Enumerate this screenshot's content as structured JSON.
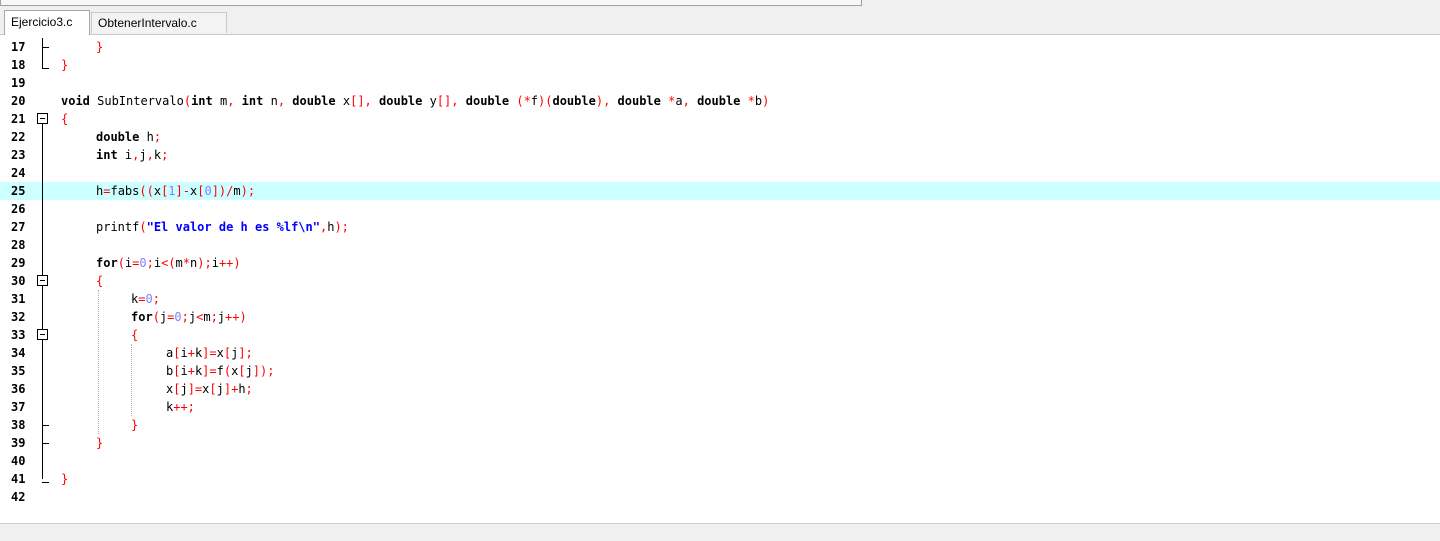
{
  "tabs": [
    {
      "label": "Ejercicio3.c",
      "active": true
    },
    {
      "label": "ObtenerIntervalo.c",
      "active": false
    }
  ],
  "editor": {
    "current_line": 25,
    "lines": [
      {
        "n": 17,
        "indent": 1,
        "tokens": [
          [
            "op",
            "}"
          ]
        ]
      },
      {
        "n": 18,
        "indent": 0,
        "tokens": [
          [
            "op",
            "}"
          ]
        ]
      },
      {
        "n": 19,
        "indent": 0,
        "tokens": []
      },
      {
        "n": 20,
        "indent": 0,
        "tokens": [
          [
            "kw",
            "void"
          ],
          [
            "id",
            " SubIntervalo"
          ],
          [
            "op",
            "("
          ],
          [
            "kw",
            "int"
          ],
          [
            "id",
            " m"
          ],
          [
            "op",
            ","
          ],
          [
            "id",
            " "
          ],
          [
            "kw",
            "int"
          ],
          [
            "id",
            " n"
          ],
          [
            "op",
            ","
          ],
          [
            "id",
            " "
          ],
          [
            "kw",
            "double"
          ],
          [
            "id",
            " x"
          ],
          [
            "op",
            "[],"
          ],
          [
            "id",
            " "
          ],
          [
            "kw",
            "double"
          ],
          [
            "id",
            " y"
          ],
          [
            "op",
            "[],"
          ],
          [
            "id",
            " "
          ],
          [
            "kw",
            "double"
          ],
          [
            "id",
            " "
          ],
          [
            "op",
            "(*"
          ],
          [
            "id",
            "f"
          ],
          [
            "op",
            ")("
          ],
          [
            "kw",
            "double"
          ],
          [
            "op",
            "),"
          ],
          [
            "id",
            " "
          ],
          [
            "kw",
            "double"
          ],
          [
            "id",
            " "
          ],
          [
            "op",
            "*"
          ],
          [
            "id",
            "a"
          ],
          [
            "op",
            ","
          ],
          [
            "id",
            " "
          ],
          [
            "kw",
            "double"
          ],
          [
            "id",
            " "
          ],
          [
            "op",
            "*"
          ],
          [
            "id",
            "b"
          ],
          [
            "op",
            ")"
          ]
        ]
      },
      {
        "n": 21,
        "indent": 0,
        "tokens": [
          [
            "op",
            "{"
          ]
        ]
      },
      {
        "n": 22,
        "indent": 1,
        "tokens": [
          [
            "kw",
            "double"
          ],
          [
            "id",
            " h"
          ],
          [
            "op",
            ";"
          ]
        ]
      },
      {
        "n": 23,
        "indent": 1,
        "tokens": [
          [
            "kw",
            "int"
          ],
          [
            "id",
            " i"
          ],
          [
            "op",
            ","
          ],
          [
            "id",
            "j"
          ],
          [
            "op",
            ","
          ],
          [
            "id",
            "k"
          ],
          [
            "op",
            ";"
          ]
        ]
      },
      {
        "n": 24,
        "indent": 0,
        "tokens": []
      },
      {
        "n": 25,
        "indent": 1,
        "tokens": [
          [
            "id",
            "h"
          ],
          [
            "op",
            "="
          ],
          [
            "id",
            "fabs"
          ],
          [
            "op",
            "(("
          ],
          [
            "id",
            "x"
          ],
          [
            "op",
            "["
          ],
          [
            "num",
            "1"
          ],
          [
            "op",
            "]-"
          ],
          [
            "id",
            "x"
          ],
          [
            "op",
            "["
          ],
          [
            "num",
            "0"
          ],
          [
            "op",
            "])/"
          ],
          [
            "id",
            "m"
          ],
          [
            "op",
            ");"
          ]
        ]
      },
      {
        "n": 26,
        "indent": 0,
        "tokens": []
      },
      {
        "n": 27,
        "indent": 1,
        "tokens": [
          [
            "id",
            "printf"
          ],
          [
            "op",
            "("
          ],
          [
            "str",
            "\"El valor de h es %lf\\n\""
          ],
          [
            "op",
            ","
          ],
          [
            "id",
            "h"
          ],
          [
            "op",
            ");"
          ]
        ]
      },
      {
        "n": 28,
        "indent": 0,
        "tokens": []
      },
      {
        "n": 29,
        "indent": 1,
        "tokens": [
          [
            "kw",
            "for"
          ],
          [
            "op",
            "("
          ],
          [
            "id",
            "i"
          ],
          [
            "op",
            "="
          ],
          [
            "num",
            "0"
          ],
          [
            "op",
            ";"
          ],
          [
            "id",
            "i"
          ],
          [
            "op",
            "<("
          ],
          [
            "id",
            "m"
          ],
          [
            "op",
            "*"
          ],
          [
            "id",
            "n"
          ],
          [
            "op",
            ");"
          ],
          [
            "id",
            "i"
          ],
          [
            "op",
            "++)"
          ]
        ]
      },
      {
        "n": 30,
        "indent": 1,
        "tokens": [
          [
            "op",
            "{"
          ]
        ]
      },
      {
        "n": 31,
        "indent": 2,
        "tokens": [
          [
            "id",
            "k"
          ],
          [
            "op",
            "="
          ],
          [
            "num",
            "0"
          ],
          [
            "op",
            ";"
          ]
        ]
      },
      {
        "n": 32,
        "indent": 2,
        "tokens": [
          [
            "kw",
            "for"
          ],
          [
            "op",
            "("
          ],
          [
            "id",
            "j"
          ],
          [
            "op",
            "="
          ],
          [
            "num",
            "0"
          ],
          [
            "op",
            ";"
          ],
          [
            "id",
            "j"
          ],
          [
            "op",
            "<"
          ],
          [
            "id",
            "m"
          ],
          [
            "op",
            ";"
          ],
          [
            "id",
            "j"
          ],
          [
            "op",
            "++)"
          ]
        ]
      },
      {
        "n": 33,
        "indent": 2,
        "tokens": [
          [
            "op",
            "{"
          ]
        ]
      },
      {
        "n": 34,
        "indent": 3,
        "tokens": [
          [
            "id",
            "a"
          ],
          [
            "op",
            "["
          ],
          [
            "id",
            "i"
          ],
          [
            "op",
            "+"
          ],
          [
            "id",
            "k"
          ],
          [
            "op",
            "]="
          ],
          [
            "id",
            "x"
          ],
          [
            "op",
            "["
          ],
          [
            "id",
            "j"
          ],
          [
            "op",
            "];"
          ]
        ]
      },
      {
        "n": 35,
        "indent": 3,
        "tokens": [
          [
            "id",
            "b"
          ],
          [
            "op",
            "["
          ],
          [
            "id",
            "i"
          ],
          [
            "op",
            "+"
          ],
          [
            "id",
            "k"
          ],
          [
            "op",
            "]="
          ],
          [
            "id",
            "f"
          ],
          [
            "op",
            "("
          ],
          [
            "id",
            "x"
          ],
          [
            "op",
            "["
          ],
          [
            "id",
            "j"
          ],
          [
            "op",
            "]);"
          ]
        ]
      },
      {
        "n": 36,
        "indent": 3,
        "tokens": [
          [
            "id",
            "x"
          ],
          [
            "op",
            "["
          ],
          [
            "id",
            "j"
          ],
          [
            "op",
            "]="
          ],
          [
            "id",
            "x"
          ],
          [
            "op",
            "["
          ],
          [
            "id",
            "j"
          ],
          [
            "op",
            "]+"
          ],
          [
            "id",
            "h"
          ],
          [
            "op",
            ";"
          ]
        ]
      },
      {
        "n": 37,
        "indent": 3,
        "tokens": [
          [
            "id",
            "k"
          ],
          [
            "op",
            "++;"
          ]
        ]
      },
      {
        "n": 38,
        "indent": 2,
        "tokens": [
          [
            "op",
            "}"
          ]
        ]
      },
      {
        "n": 39,
        "indent": 1,
        "tokens": [
          [
            "op",
            "}"
          ]
        ]
      },
      {
        "n": 40,
        "indent": 0,
        "tokens": []
      },
      {
        "n": 41,
        "indent": 0,
        "tokens": [
          [
            "op",
            "}"
          ]
        ]
      },
      {
        "n": 42,
        "indent": 0,
        "tokens": []
      }
    ],
    "fold_markers": [
      {
        "line": 17,
        "type": "tick"
      },
      {
        "line": 18,
        "type": "end"
      },
      {
        "line": 21,
        "type": "box"
      },
      {
        "line": 30,
        "type": "box"
      },
      {
        "line": 33,
        "type": "box"
      },
      {
        "line": 38,
        "type": "tick"
      },
      {
        "line": 39,
        "type": "tick"
      },
      {
        "line": 41,
        "type": "end"
      }
    ],
    "colors": {
      "keyword": "#000000",
      "operator": "#ff0000",
      "number": "#8080ff",
      "string": "#0000ff",
      "current_line_bg": "#ccffff"
    }
  }
}
